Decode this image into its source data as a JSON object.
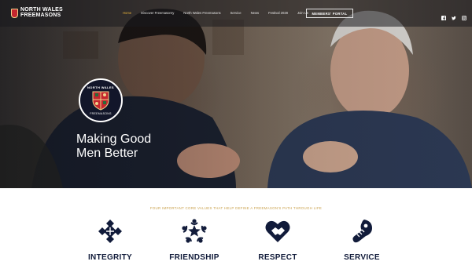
{
  "brand": {
    "line1": "NORTH WALES",
    "line2": "FREEMASONS"
  },
  "nav": [
    {
      "label": "Home",
      "active": true
    },
    {
      "label": "Discover Freemasonry",
      "active": false
    },
    {
      "label": "North Wales Freemasons",
      "active": false
    },
    {
      "label": "Service",
      "active": false
    },
    {
      "label": "News",
      "active": false
    },
    {
      "label": "Festival 2028",
      "active": false
    },
    {
      "label": "Join Us",
      "active": false
    }
  ],
  "portal_button": "MEMBERS' PORTAL",
  "social": [
    "facebook-icon",
    "twitter-icon",
    "instagram-icon"
  ],
  "logo": {
    "top_text": "NORTH WALES",
    "bottom_text": "FREEMASONS"
  },
  "hero": {
    "headline_line1": "Making Good",
    "headline_line2": "Men Better"
  },
  "values_tagline": "FOUR IMPORTANT CORE VALUES THAT HELP DEFINE A FREEMASON'S PATH THROUGH LIFE",
  "values": [
    {
      "label": "INTEGRITY",
      "icon": "integrity-icon"
    },
    {
      "label": "FRIENDSHIP",
      "icon": "friendship-icon"
    },
    {
      "label": "RESPECT",
      "icon": "respect-icon"
    },
    {
      "label": "SERVICE",
      "icon": "service-icon"
    }
  ],
  "colors": {
    "accent": "#e7b23b",
    "navy": "#111b3a",
    "gold_text": "#c9a04a"
  }
}
